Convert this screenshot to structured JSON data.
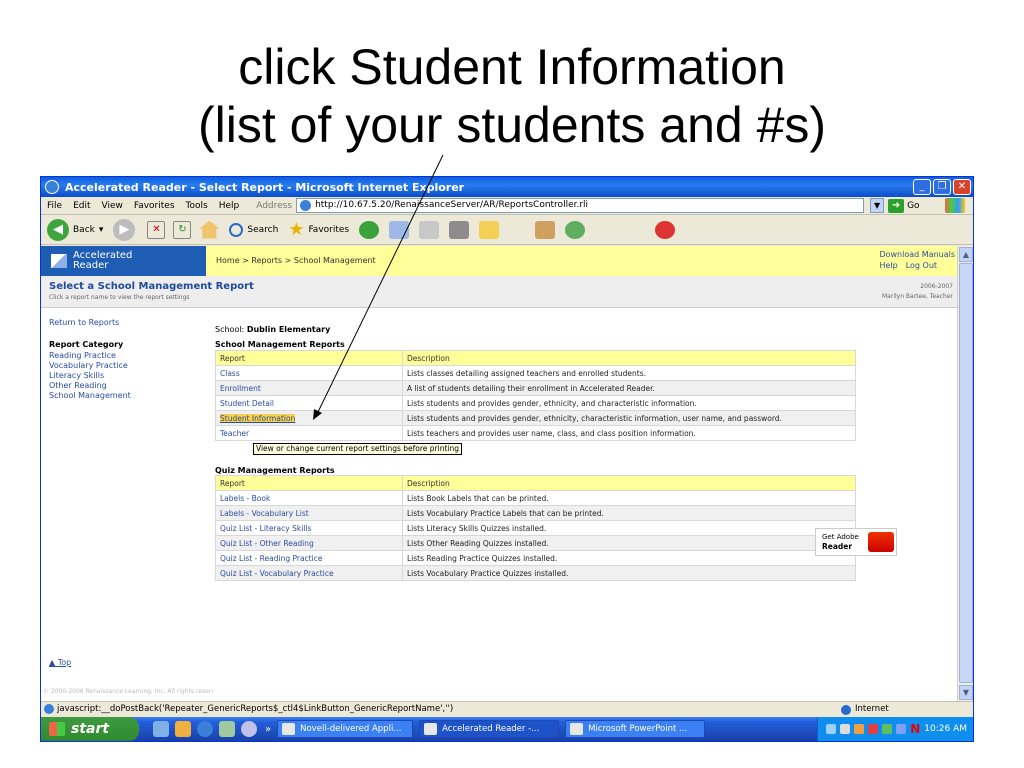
{
  "slide": {
    "title_line1": "click Student Information",
    "title_line2": "(list of your students and #s)"
  },
  "window": {
    "title": "Accelerated Reader - Select Report - Microsoft Internet Explorer",
    "menu": [
      "File",
      "Edit",
      "View",
      "Favorites",
      "Tools",
      "Help"
    ],
    "address_label": "Address",
    "address_value": "http://10.67.5.20/RenaissanceServer/AR/ReportsController.rli",
    "go_label": "Go",
    "toolbar": {
      "back_label": "Back",
      "search_label": "Search",
      "favorites_label": "Favorites"
    }
  },
  "app": {
    "logo_line1": "Accelerated",
    "logo_line2": "Reader",
    "breadcrumb": "Home > Reports > School Management",
    "header_links": {
      "download_manuals": "Download Manuals",
      "help": "Help",
      "logout": "Log Out"
    },
    "page_heading": "Select a School Management Report",
    "page_subheading": "Click a report name to view the report settings",
    "school_year": "2006-2007",
    "user": "Marilyn Bartee, Teacher",
    "left_nav": {
      "return_link": "Return to Reports",
      "category_heading": "Report Category",
      "categories": [
        "Reading Practice",
        "Vocabulary Practice",
        "Literacy Skills",
        "Other Reading",
        "School Management"
      ],
      "top_link": "Top",
      "copyright": "© 2000-2006 Renaissance Learning, Inc. All rights reserved."
    },
    "school_label": "School:",
    "school_name": "Dublin Elementary",
    "school_reports_heading": "School Management Reports",
    "quiz_reports_heading": "Quiz Management Reports",
    "col_report": "Report",
    "col_description": "Description",
    "school_reports": [
      {
        "name": "Class",
        "desc": "Lists classes detailing assigned teachers and enrolled students."
      },
      {
        "name": "Enrollment",
        "desc": "A list of students detailing their enrollment in Accelerated Reader."
      },
      {
        "name": "Student Detail",
        "desc": "Lists students and provides gender, ethnicity, and characteristic information."
      },
      {
        "name": "Student Information",
        "desc": "Lists students and provides gender, ethnicity, characteristic information, user name, and password."
      },
      {
        "name": "Teacher",
        "desc": "Lists teachers and provides user name, class, and class position information."
      }
    ],
    "quiz_reports": [
      {
        "name": "Labels - Book",
        "desc": "Lists Book Labels that can be printed."
      },
      {
        "name": "Labels - Vocabulary List",
        "desc": "Lists Vocabulary Practice Labels that can be printed."
      },
      {
        "name": "Quiz List - Literacy Skills",
        "desc": "Lists Literacy Skills Quizzes installed."
      },
      {
        "name": "Quiz List - Other Reading",
        "desc": "Lists Other Reading Quizzes installed."
      },
      {
        "name": "Quiz List - Reading Practice",
        "desc": "Lists Reading Practice Quizzes installed."
      },
      {
        "name": "Quiz List - Vocabulary Practice",
        "desc": "Lists Vocabulary Practice Quizzes installed."
      }
    ],
    "tooltip": "View or change current report settings before printing",
    "adobe_line1": "Get Adobe",
    "adobe_line2": "Reader"
  },
  "status": {
    "text": "javascript:__doPostBack('Repeater_GenericReports$_ctl4$LinkButton_GenericReportName','')",
    "zone": "Internet"
  },
  "taskbar": {
    "start_label": "start",
    "buttons": [
      "Novell-delivered Appli...",
      "Accelerated Reader -...",
      "Microsoft PowerPoint ..."
    ],
    "clock": "10:26 AM"
  }
}
